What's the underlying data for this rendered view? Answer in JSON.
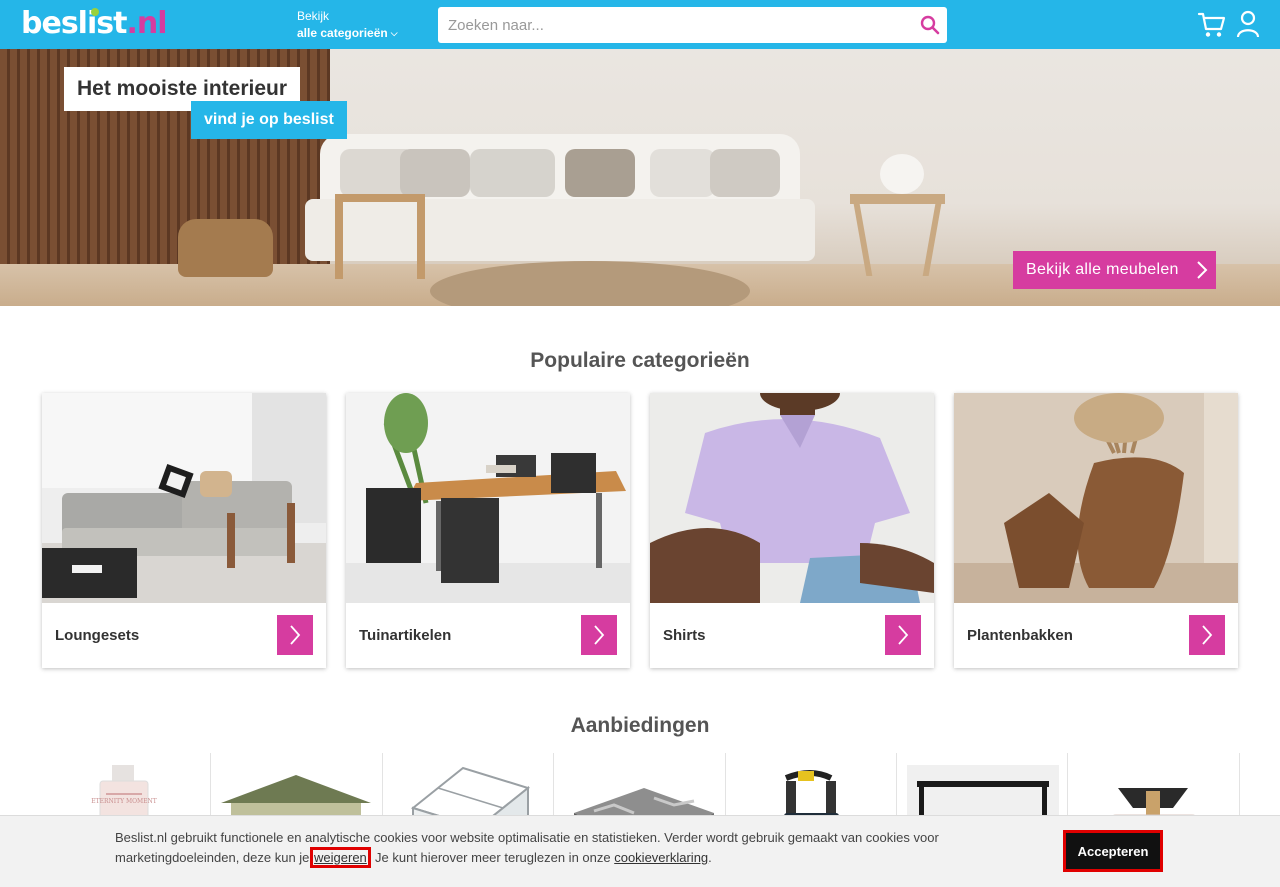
{
  "header": {
    "logo_main": "beslist",
    "logo_tld": ".nl",
    "browse_small": "Bekijk",
    "browse_big": "alle categorieën",
    "browse_chevron": "⌵",
    "search_placeholder": "Zoeken naar...",
    "icons": [
      "search-icon",
      "cart-icon",
      "user-icon"
    ]
  },
  "hero": {
    "title": "Het mooiste interieur",
    "subtitle": "vind je op beslist",
    "cta": "Bekijk alle meubelen"
  },
  "popular": {
    "title": "Populaire categorieën",
    "cards": [
      {
        "label": "Loungesets"
      },
      {
        "label": "Tuinartikelen"
      },
      {
        "label": "Shirts"
      },
      {
        "label": "Plantenbakken"
      }
    ]
  },
  "offers": {
    "title": "Aanbiedingen",
    "items": [
      {
        "name": "perfume-bottle",
        "caption": "ETERNITY MOMENT"
      },
      {
        "name": "garden-house",
        "caption": ""
      },
      {
        "name": "greenhouse",
        "caption": ""
      },
      {
        "name": "garden-tiles",
        "caption": ""
      },
      {
        "name": "rollator",
        "caption": ""
      },
      {
        "name": "black-side-table",
        "caption": ""
      },
      {
        "name": "perfume-gold",
        "caption": ""
      }
    ]
  },
  "cookie": {
    "text_1": "Beslist.nl gebruikt functionele en analytische cookies voor website optimalisatie en statistieken. Verder wordt gebruik gemaakt van cookies voor marketingdoeleinden, deze kun je ",
    "refuse": "weigeren",
    "text_2": ". Je kunt hierover meer teruglezen in onze ",
    "policy": "cookieverklaring",
    "text_3": ".",
    "accept": "Accepteren"
  },
  "colors": {
    "brand_blue": "#25b6e8",
    "brand_pink": "#d63ca0",
    "logo_dot": "#9ad13b",
    "highlight": "#e00000"
  }
}
